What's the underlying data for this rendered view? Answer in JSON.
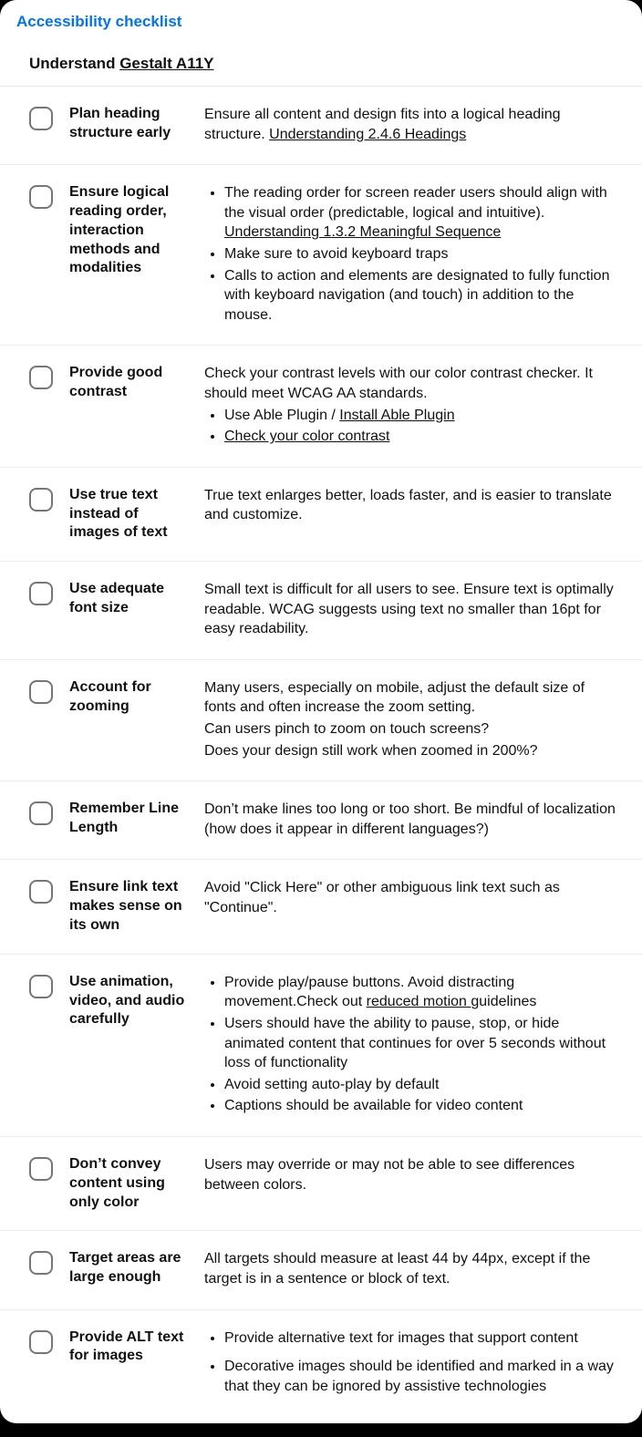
{
  "tab": "Accessibility checklist",
  "subtitle_prefix": "Understand ",
  "subtitle_link": "Gestalt A11Y",
  "items": [
    {
      "label": "Plan heading structure early",
      "desc_before": "Ensure all content and design fits into a logical heading structure. ",
      "link": "Understanding 2.4.6 Headings"
    },
    {
      "label": "Ensure logical reading order, interaction methods and modalities",
      "bullets": [
        {
          "before": "The reading order for screen reader users should align with the visual order (predictable, logical and intuitive). ",
          "link": "Understanding 1.3.2 Meaningful Sequence"
        },
        {
          "text": "Make sure to avoid keyboard traps"
        },
        {
          "text": "Calls to action and elements are designated to fully function with keyboard navigation (and touch) in addition to the mouse."
        }
      ]
    },
    {
      "label": "Provide good contrast",
      "intro": "Check your contrast levels with our color contrast checker. It should meet WCAG AA standards.",
      "bullets": [
        {
          "before": "Use Able Plugin / ",
          "link": "Install Able Plugin"
        },
        {
          "link": "Check your color contrast"
        }
      ]
    },
    {
      "label": "Use true text instead of images of text",
      "text": "True text enlarges better, loads faster, and is easier to translate and customize."
    },
    {
      "label": "Use adequate font size",
      "text": "Small text is difficult for all users to see. Ensure text is optimally readable. WCAG suggests using text no smaller than 16pt for easy readability."
    },
    {
      "label": "Account for zooming",
      "lines": [
        "Many users, especially on mobile, adjust the default size of fonts and often increase the zoom setting.",
        "Can users pinch to zoom on touch screens?",
        "Does your design still work when zoomed in 200%?"
      ]
    },
    {
      "label": "Remember Line Length",
      "text": "Don’t make lines too long or too short. Be mindful of localization (how does it appear in different languages?)"
    },
    {
      "label": "Ensure link text makes sense on its own",
      "text": "Avoid \"Click Here\" or other ambiguous link text such as \"Continue\"."
    },
    {
      "label": "Use animation, video, and audio carefully",
      "bullets": [
        {
          "before": "Provide play/pause buttons. Avoid distracting movement.Check out ",
          "link": "reduced motion ",
          "after": "guidelines"
        },
        {
          "text": "Users should have the ability to pause, stop, or hide animated content that continues for over 5 seconds without loss of functionality"
        },
        {
          "text": "Avoid setting auto-play by default"
        },
        {
          "text": "Captions should be available for video content"
        }
      ]
    },
    {
      "label": "Don’t convey content using only color",
      "text": "Users may override or may not be able to see differences between colors."
    },
    {
      "label": "Target areas are large enough",
      "text": "All targets should measure at least 44 by 44px, except if the target is in a sentence or block of text."
    },
    {
      "label": "Provide ALT text for images",
      "spaced_bullets": [
        {
          "text": "Provide alternative text for images that support content"
        },
        {
          "text": "Decorative images should be identified and marked in a way that they can be ignored by assistive technologies"
        }
      ]
    }
  ]
}
